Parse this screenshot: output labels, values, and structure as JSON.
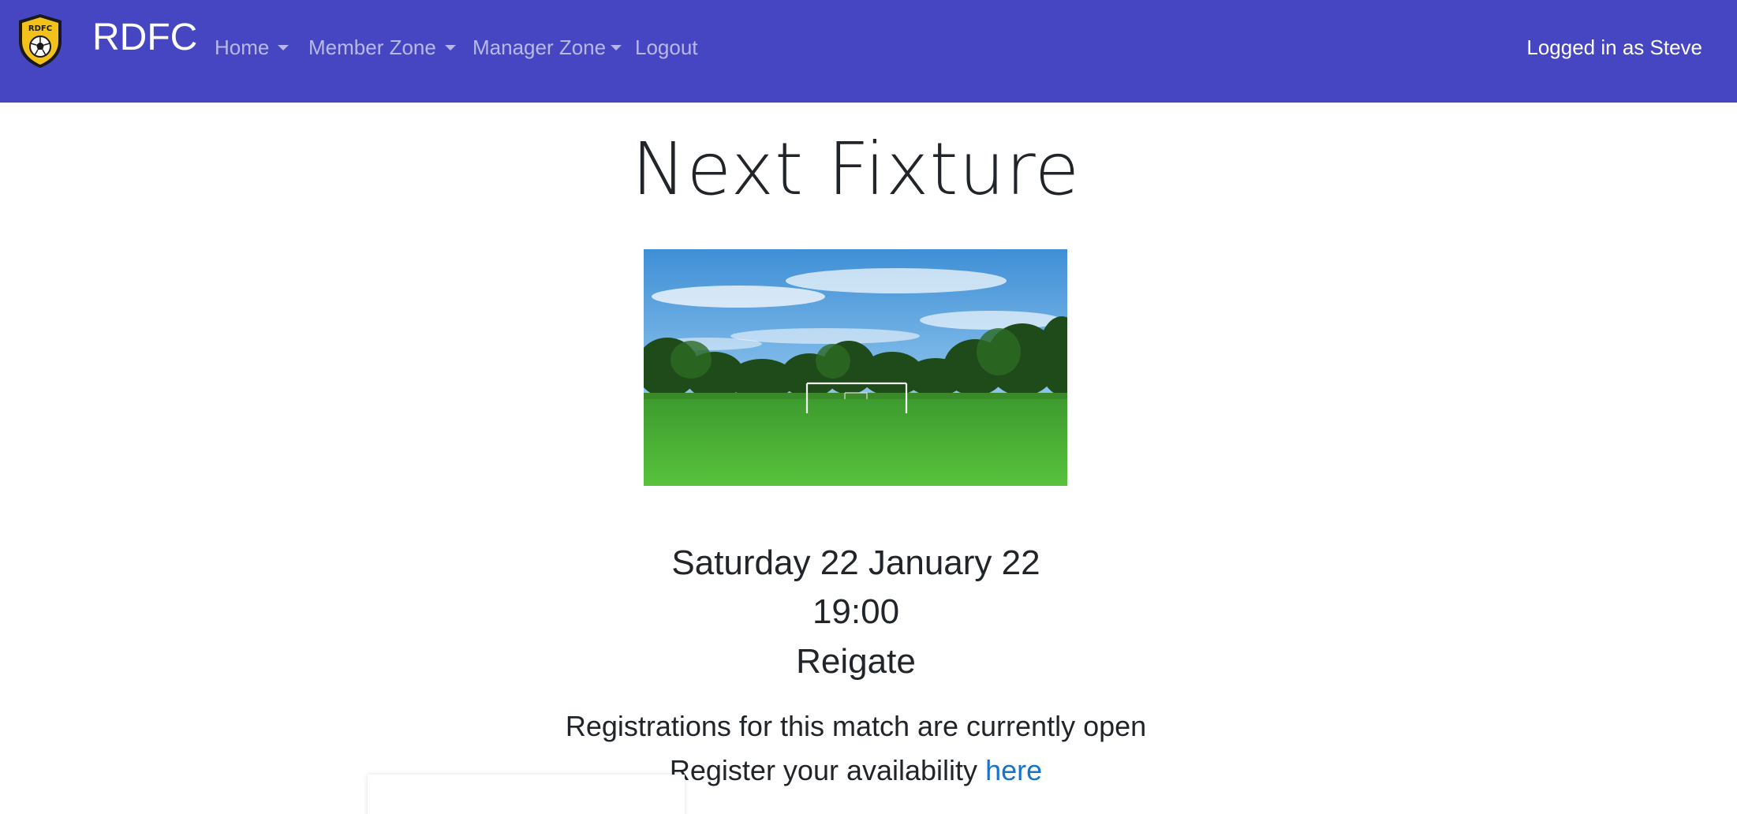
{
  "navbar": {
    "logo_text": "RDFC",
    "brand": "RDFC",
    "items": [
      {
        "label": "Home",
        "dropdown": true
      },
      {
        "label": "Member Zone",
        "dropdown": true
      },
      {
        "label": "Manager Zone",
        "dropdown": true
      },
      {
        "label": "Logout",
        "dropdown": false
      }
    ],
    "user_status": "Logged in as Steve",
    "background_color": "#4646c2"
  },
  "main": {
    "title": "Next Fixture",
    "image_icon": "football-pitch-image",
    "fixture": {
      "date": "Saturday 22 January 22",
      "time": "19:00",
      "venue": "Reigate"
    },
    "registration": {
      "status": "Registrations for this match are currently open",
      "prompt": "Register your availability",
      "link_label": "here",
      "link_color": "#1a73c8"
    }
  }
}
